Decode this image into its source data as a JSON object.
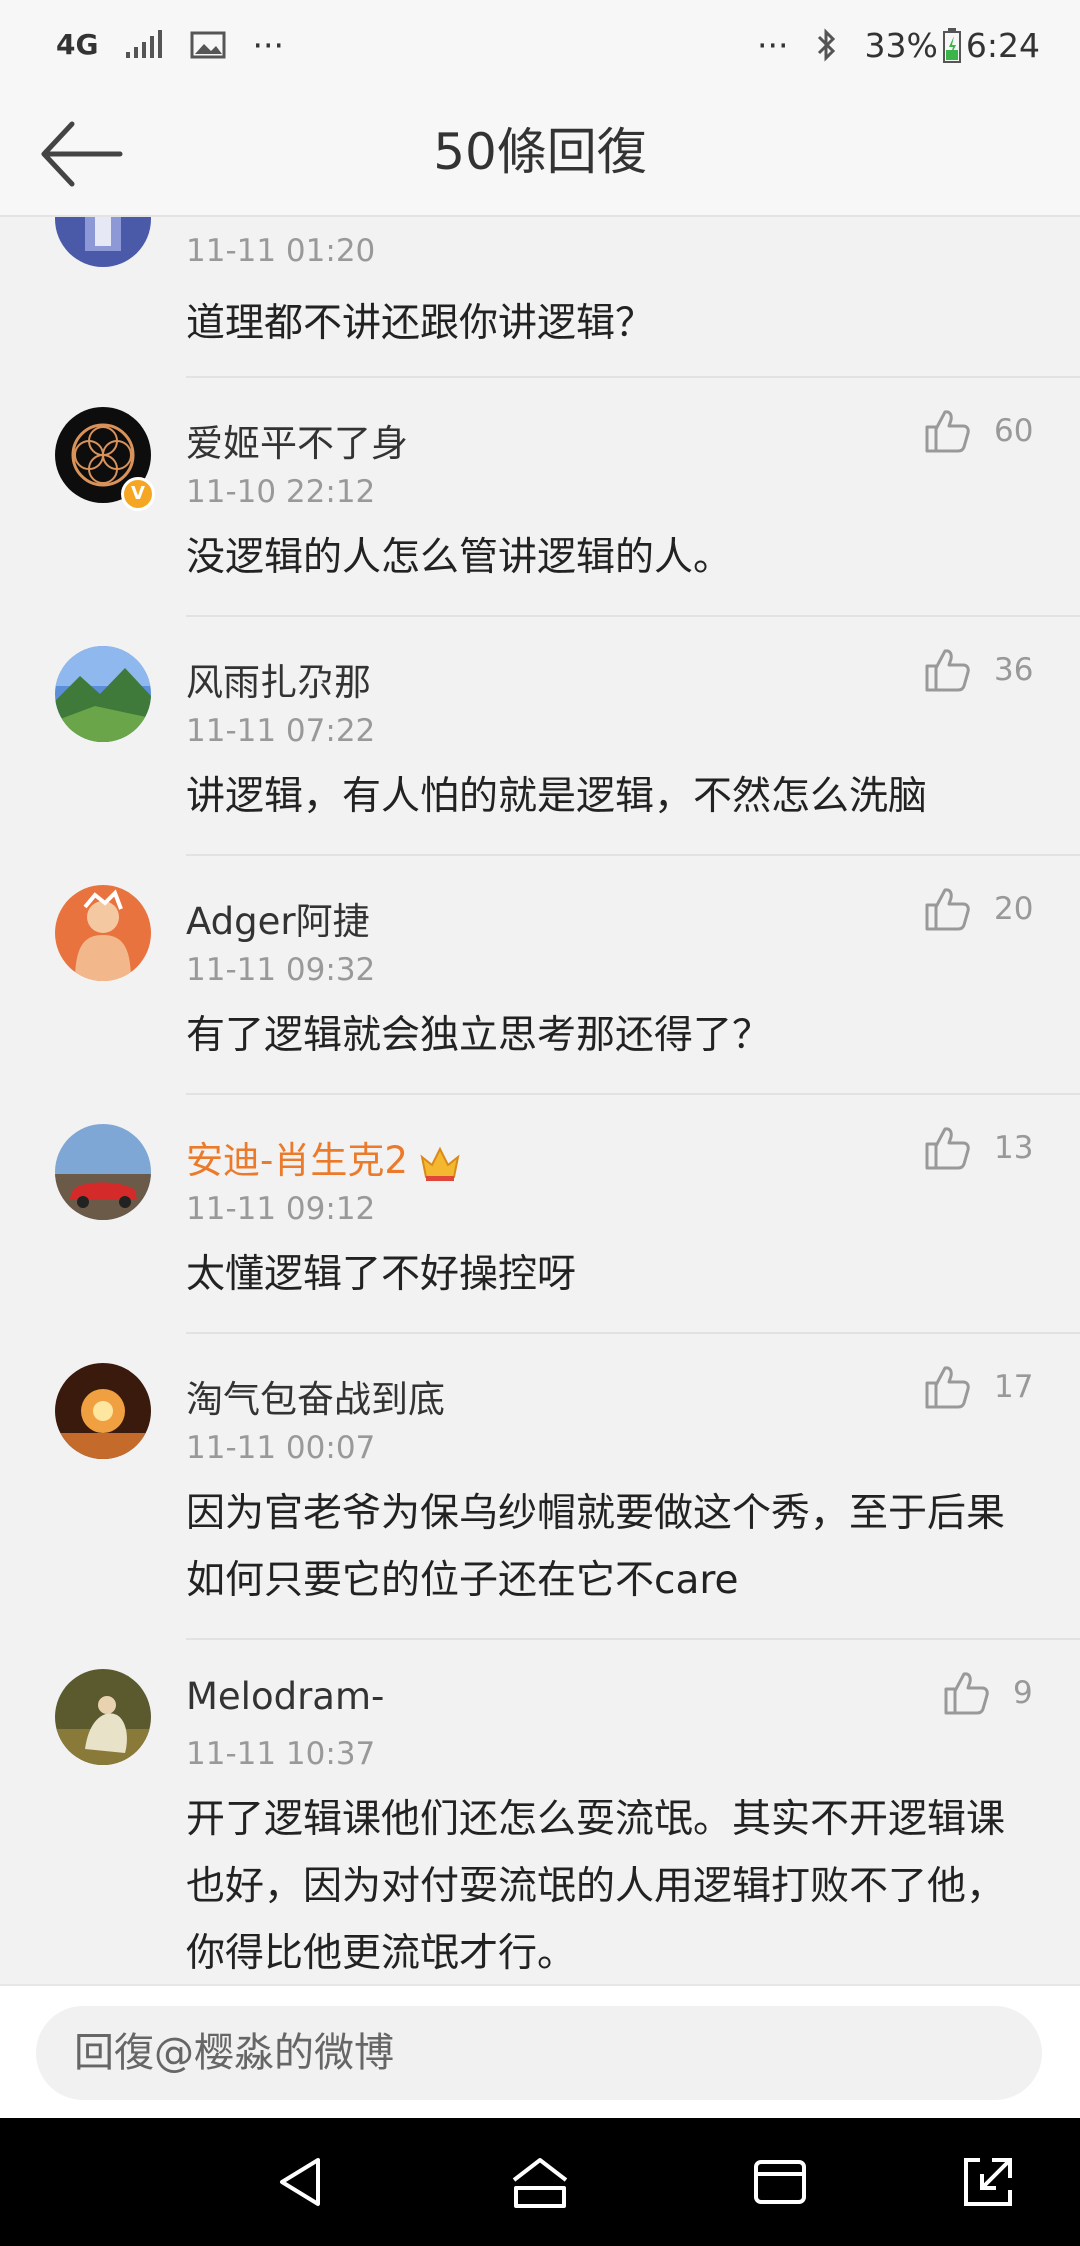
{
  "status_bar": {
    "network": "4G",
    "more_left": "···",
    "more_right": "···",
    "battery": "33%",
    "time": "6:24"
  },
  "header": {
    "title": "50條回復"
  },
  "comments": [
    {
      "id": 0,
      "username": "",
      "time": "11-11 01:20",
      "text": "道理都不讲还跟你讲逻辑？",
      "likes": ""
    },
    {
      "id": 1,
      "username": "爱姬平不了身",
      "time": "11-10 22:12",
      "text": "没逻辑的人怎么管讲逻辑的人。",
      "likes": "60",
      "verified": true
    },
    {
      "id": 2,
      "username": "风雨扎尕那",
      "time": "11-11 07:22",
      "text": "讲逻辑，有人怕的就是逻辑，不然怎么洗脑",
      "likes": "36"
    },
    {
      "id": 3,
      "username": "Adger阿捷",
      "time": "11-11 09:32",
      "text": "有了逻辑就会独立思考那还得了？",
      "likes": "20"
    },
    {
      "id": 4,
      "username": "安迪-肖生克2",
      "time": "11-11 09:12",
      "text": "太懂逻辑了不好操控呀",
      "likes": "13",
      "vip": true
    },
    {
      "id": 5,
      "username": "淘气包奋战到底",
      "time": "11-11 00:07",
      "text": "因为官老爷为保乌纱帽就要做这个秀，至于后果如何只要它的位子还在它不care",
      "likes": "17"
    },
    {
      "id": 6,
      "username": "Melodram-",
      "time": "11-11 10:37",
      "text": "开了逻辑课他们还怎么耍流氓。其实不开逻辑课也好，因为对付耍流氓的人用逻辑打败不了他，你得比他更流氓才行。",
      "likes": "9"
    }
  ],
  "reply": {
    "placeholder": "回復@樱淼的微博"
  },
  "colors": {
    "vip_name": "#eb7a2a",
    "meta": "#999999",
    "verified_badge": "#f5a623"
  }
}
